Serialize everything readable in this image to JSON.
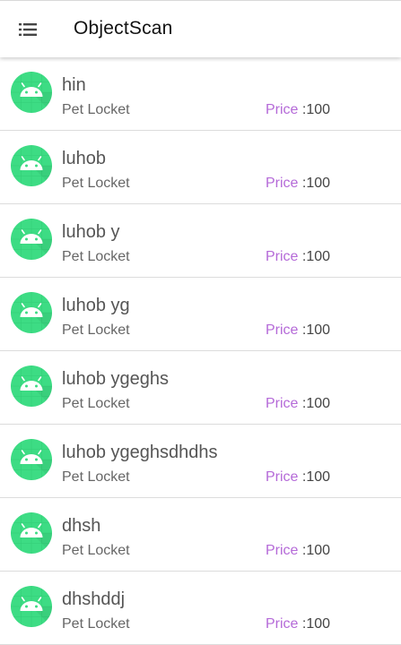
{
  "app": {
    "title": "ObjectScan",
    "menu_icon": "list-menu-icon"
  },
  "colors": {
    "avatar_bg": "#3ddc84",
    "price_label": "#b56ad8"
  },
  "items": [
    {
      "name": "hin",
      "subtitle": "Pet Locket",
      "price_label": "Price",
      "price_sep": " :",
      "price_value": "100",
      "icon": "android-icon"
    },
    {
      "name": "luhob",
      "subtitle": "Pet Locket",
      "price_label": "Price",
      "price_sep": " :",
      "price_value": "100",
      "icon": "android-icon"
    },
    {
      "name": "luhob y",
      "subtitle": "Pet Locket",
      "price_label": "Price",
      "price_sep": " :",
      "price_value": "100",
      "icon": "android-icon"
    },
    {
      "name": "luhob yg",
      "subtitle": "Pet Locket",
      "price_label": "Price",
      "price_sep": " :",
      "price_value": "100",
      "icon": "android-icon"
    },
    {
      "name": "luhob ygeghs",
      "subtitle": "Pet Locket",
      "price_label": "Price",
      "price_sep": " :",
      "price_value": "100",
      "icon": "android-icon"
    },
    {
      "name": "luhob ygeghsdhdhs",
      "subtitle": "Pet Locket",
      "price_label": "Price",
      "price_sep": " :",
      "price_value": "100",
      "icon": "android-icon"
    },
    {
      "name": "dhsh",
      "subtitle": "Pet Locket",
      "price_label": "Price",
      "price_sep": " :",
      "price_value": "100",
      "icon": "android-icon"
    },
    {
      "name": "dhshddj",
      "subtitle": "Pet Locket",
      "price_label": "Price",
      "price_sep": " :",
      "price_value": "100",
      "icon": "android-icon"
    }
  ]
}
